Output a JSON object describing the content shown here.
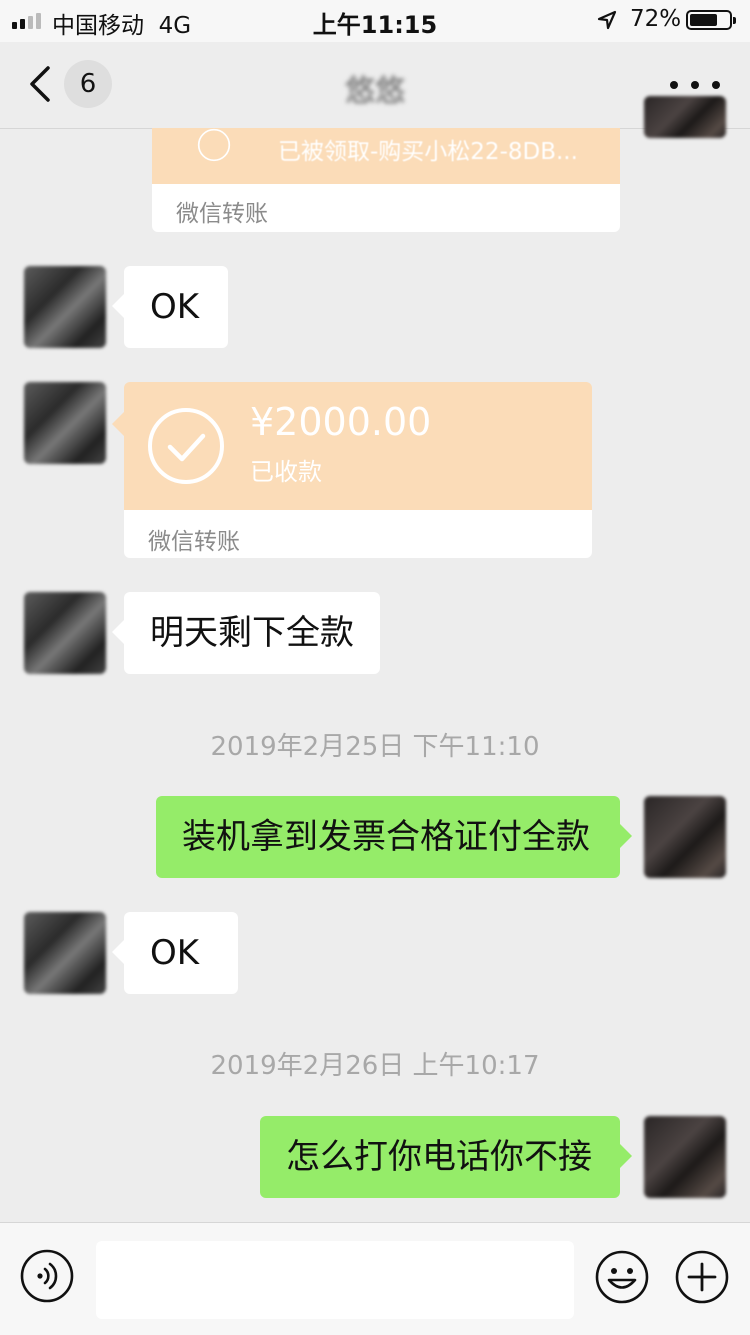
{
  "status_bar": {
    "carrier": "中国移动",
    "network": "4G",
    "time": "上午11:15",
    "battery_percent": "72%",
    "battery_level": 0.72
  },
  "nav": {
    "unread_count": "6",
    "chat_title": "悠悠"
  },
  "messages": {
    "partial_transfer": {
      "status": "已被领取-购买小松22-8DB...",
      "label": "微信转账"
    },
    "m1": {
      "text": "OK"
    },
    "transfer": {
      "amount": "¥2000.00",
      "status": "已收款",
      "label": "微信转账"
    },
    "m2": {
      "text": "明天剩下全款"
    },
    "ts1": "2019年2月25日 下午11:10",
    "m3": {
      "text": "装机拿到发票合格证付全款"
    },
    "m4": {
      "text": "OK"
    },
    "ts2": "2019年2月26日 上午10:17",
    "m5": {
      "text": "怎么打你电话你不接"
    }
  },
  "input_bar": {
    "value": "",
    "icons": [
      "voice-icon",
      "emoji-icon",
      "plus-icon"
    ]
  },
  "colors": {
    "bubble_green": "#95ec69",
    "bubble_white": "#ffffff",
    "transfer_orange": "#fbdcb8",
    "background": "#ededed"
  }
}
